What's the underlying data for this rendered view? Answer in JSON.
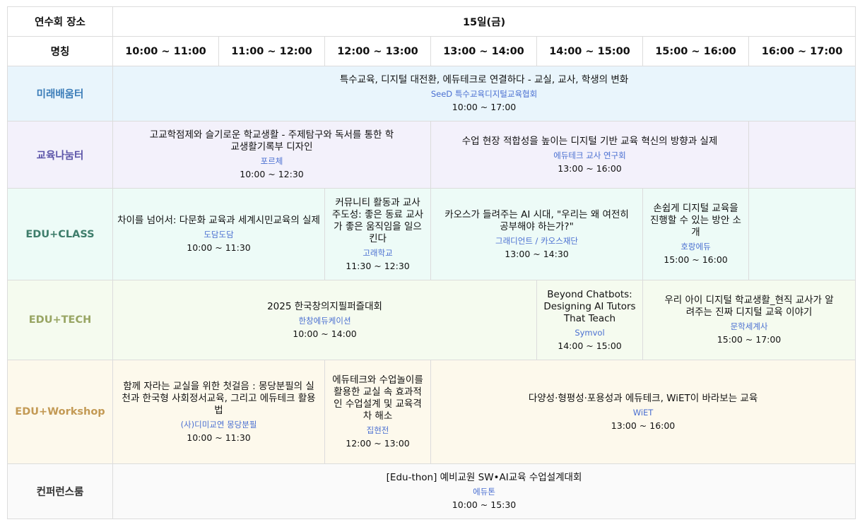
{
  "header": {
    "venue_label": "연수회 장소",
    "day_label": "15일(금)",
    "name_label": "명칭",
    "times": [
      "10:00 ~ 11:00",
      "11:00 ~ 12:00",
      "12:00 ~ 13:00",
      "13:00 ~ 14:00",
      "14:00 ~ 15:00",
      "15:00 ~ 16:00",
      "16:00 ~ 17:00"
    ]
  },
  "rows": {
    "mirae": {
      "room": "미래배움터",
      "s1": {
        "title": "특수교육, 디지털 대전환, 에듀테크로 연결하다 - 교실, 교사, 학생의 변화",
        "org": "SeeD 특수교육디지털교육협회",
        "time": "10:00 ~ 17:00"
      }
    },
    "nanum": {
      "room": "교육나눔터",
      "s1": {
        "title": "고교학점제와 슬기로운 학교생활 - 주제탐구와 독서를 통한 학교생활기록부 디자인",
        "org": "포르체",
        "time": "10:00 ~ 12:30"
      },
      "s2": {
        "title": "수업 현장 적합성을 높이는 디지털 기반 교육 혁신의 방향과 실제",
        "org": "에듀테크 교사 연구회",
        "time": "13:00 ~ 16:00"
      }
    },
    "class": {
      "room": "EDU+CLASS",
      "s1": {
        "title": "차이를 넘어서: 다문화 교육과 세계시민교육의 실제",
        "org": "도담도담",
        "time": "10:00 ~ 11:30"
      },
      "s2": {
        "title": "커뮤니티 활동과 교사 주도성: 좋은 동료 교사가 좋은 움직임을 일으킨다",
        "org": "고래학교",
        "time": "11:30 ~ 12:30"
      },
      "s3": {
        "title": "카오스가 들려주는 AI 시대, \"우리는 왜 여전히 공부해야 하는가?\"",
        "org": "그래디언트 / 카오스재단",
        "time": "13:00 ~ 14:30"
      },
      "s4": {
        "title": "손쉽게 디지털 교육을 진행할 수 있는 방안 소개",
        "org": "호랑에듀",
        "time": "15:00 ~ 16:00"
      }
    },
    "tech": {
      "room": "EDU+TECH",
      "s1": {
        "title": "2025 한국창의지필퍼즐대회",
        "org": "한창에듀케이션",
        "time": "10:00 ~ 14:00"
      },
      "s2": {
        "title": "Beyond Chatbots: Designing AI Tutors That Teach",
        "org": "Symvol",
        "time": "14:00 ~ 15:00"
      },
      "s3": {
        "title": "우리 아이 디지털 학교생활_현직 교사가 알려주는 진짜 디지털 교육 이야기",
        "org": "문학세계사",
        "time": "15:00 ~ 17:00"
      }
    },
    "work": {
      "room": "EDU+Workshop",
      "s1": {
        "title": "함께 자라는 교실을 위한 첫걸음 : 몽당분필의 실천과 한국형 사회정서교육, 그리고 에듀테크 활용법",
        "org": "(사)디미교연 몽당분필",
        "time": "10:00 ~ 11:30"
      },
      "s2": {
        "title": "에듀테크와 수업놀이를 활용한 교실 속 효과적인 수업설계 및 교육격차 해소",
        "org": "집현전",
        "time": "12:00 ~ 13:00"
      },
      "s3": {
        "title": "다양성·형평성·포용성과 에듀테크, WiET이 바라보는 교육",
        "org": "WiET",
        "time": "13:00 ~ 16:00"
      }
    },
    "conf": {
      "room": "컨퍼런스룸",
      "s1": {
        "title": "[Edu-thon] 예비교원 SW•AI교육 수업설계대회",
        "org": "에듀톤",
        "time": "10:00 ~ 15:30"
      }
    }
  }
}
